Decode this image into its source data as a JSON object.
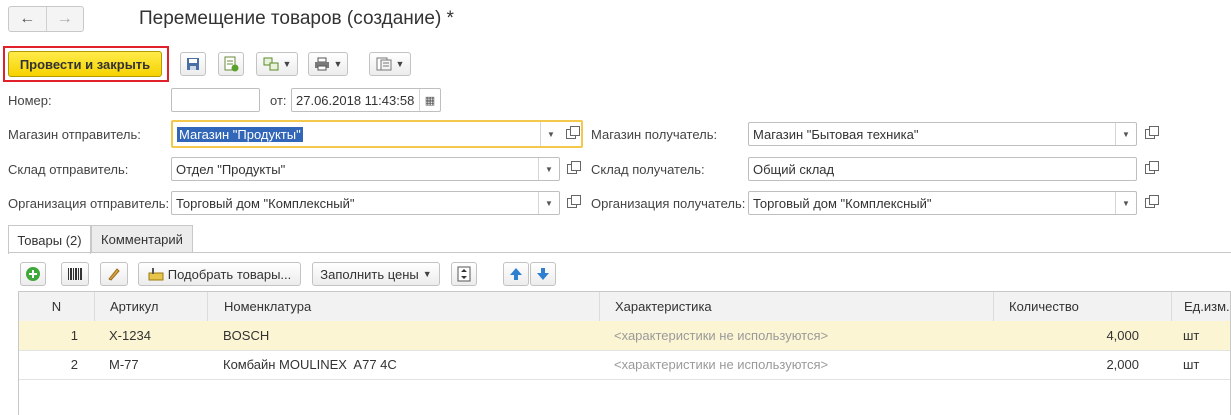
{
  "window": {
    "title": "Перемещение товаров (создание) *"
  },
  "toolbar": {
    "post_and_close_label": "Провести и закрыть"
  },
  "form": {
    "number_label": "Номер:",
    "number_value": "",
    "date_label": "от:",
    "date_value": "27.06.2018 11:43:58",
    "store_sender_label": "Магазин отправитель:",
    "store_sender_value": "Магазин \"Продукты\"",
    "store_receiver_label": "Магазин получатель:",
    "store_receiver_value": "Магазин \"Бытовая техника\"",
    "warehouse_sender_label": "Склад отправитель:",
    "warehouse_sender_value": "Отдел \"Продукты\"",
    "warehouse_receiver_label": "Склад получатель:",
    "warehouse_receiver_value": "Общий склад",
    "org_sender_label": "Организация отправитель:",
    "org_sender_value": "Торговый дом \"Комплексный\"",
    "org_receiver_label": "Организация получатель:",
    "org_receiver_value": "Торговый дом \"Комплексный\""
  },
  "tabs": [
    {
      "label": "Товары (2)",
      "active": true
    },
    {
      "label": "Комментарий",
      "active": false
    }
  ],
  "table_toolbar": {
    "pick_goods_label": "Подобрать товары...",
    "fill_prices_label": "Заполнить цены"
  },
  "table": {
    "columns": [
      "N",
      "Артикул",
      "Номенклатура",
      "Характеристика",
      "Количество",
      "Ед.изм."
    ],
    "rows": [
      {
        "n": "1",
        "article": "X-1234",
        "item": "BOSCH",
        "characteristic": "<характеристики не используются>",
        "qty": "4,000",
        "unit": "шт",
        "selected": true
      },
      {
        "n": "2",
        "article": "M-77",
        "item": "Комбайн MOULINEX  A77 4C",
        "characteristic": "<характеристики не используются>",
        "qty": "2,000",
        "unit": "шт",
        "selected": false
      }
    ]
  },
  "colors": {
    "primary_button": "#f6d200",
    "highlight_frame": "#e0202a",
    "selected_row": "#fbf5d3",
    "selection": "#3166b8",
    "focus_border": "#f2c94c"
  }
}
